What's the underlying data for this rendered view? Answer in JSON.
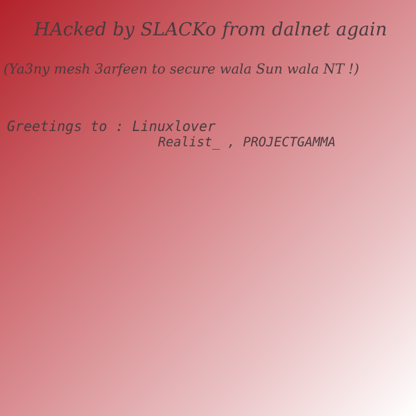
{
  "headline": "HAcked by SLACKo from dalnet again",
  "subline": "(Ya3ny mesh 3arfeen to secure wala Sun wala NT !)",
  "greetings": {
    "line1": "Greetings to : Linuxlover",
    "line2": "Realist_ , PROJECTGAMMA"
  },
  "colors": {
    "gradient_start": "#b3222a",
    "gradient_end": "#ffffff",
    "text": "#4a3a3e"
  }
}
